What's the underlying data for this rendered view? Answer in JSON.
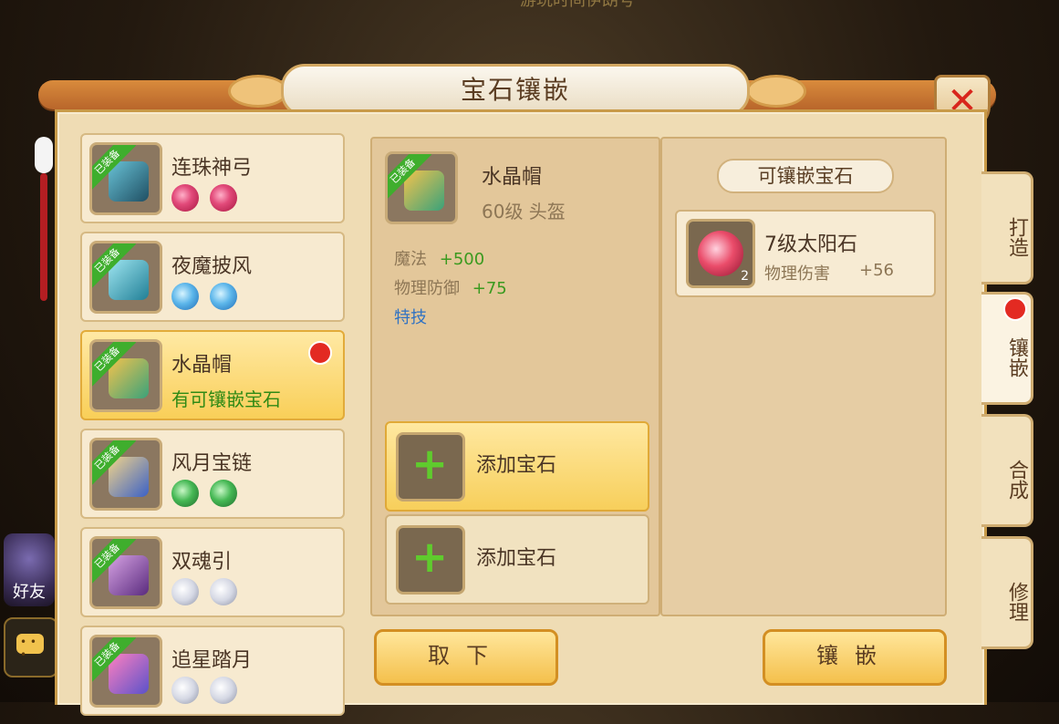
{
  "background": {
    "top_text": "游玩时间伊朗号"
  },
  "window": {
    "title": "宝石镶嵌"
  },
  "left_overlay": {
    "friend_label": "好友"
  },
  "equipment_list": [
    {
      "name": "连珠神弓",
      "badge": "已装备",
      "gems": [
        "red",
        "red"
      ]
    },
    {
      "name": "夜魔披风",
      "badge": "已装备",
      "gems": [
        "blue",
        "blue"
      ]
    },
    {
      "name": "水晶帽",
      "badge": "已装备",
      "sub": "有可镶嵌宝石",
      "selected": true,
      "alert": true
    },
    {
      "name": "风月宝链",
      "badge": "已装备",
      "gems": [
        "green",
        "green"
      ]
    },
    {
      "name": "双魂引",
      "badge": "已装备",
      "gems": [
        "white",
        "white"
      ]
    },
    {
      "name": "追星踏月",
      "badge": "已装备",
      "gems": [
        "white",
        "white"
      ]
    }
  ],
  "detail": {
    "badge": "已装备",
    "name": "水晶帽",
    "level": "60级 头盔",
    "stats": [
      {
        "key": "魔法",
        "value": "+500"
      },
      {
        "key": "物理防御",
        "value": "+75"
      }
    ],
    "special": "特技",
    "add_slots": [
      {
        "label": "添加宝石",
        "active": true
      },
      {
        "label": "添加宝石",
        "active": false
      }
    ]
  },
  "gem_panel": {
    "title": "可镶嵌宝石",
    "gems": [
      {
        "name": "7级太阳石",
        "count": "2",
        "stat_key": "物理伤害",
        "stat_value": "+56"
      }
    ]
  },
  "tabs": [
    {
      "label": "打造",
      "active": false
    },
    {
      "label": "镶嵌",
      "active": true,
      "alert": true
    },
    {
      "label": "合成",
      "active": false
    },
    {
      "label": "修理",
      "active": false
    }
  ],
  "buttons": {
    "remove": "取下",
    "embed": "镶嵌"
  },
  "colors": {
    "gem_red": "#e24a7a",
    "gem_blue": "#5cb6ea",
    "gem_green": "#45b854",
    "gem_white": "#d5d8e4",
    "accent_green": "#3a9a1f",
    "alert_red": "#e32a22"
  }
}
